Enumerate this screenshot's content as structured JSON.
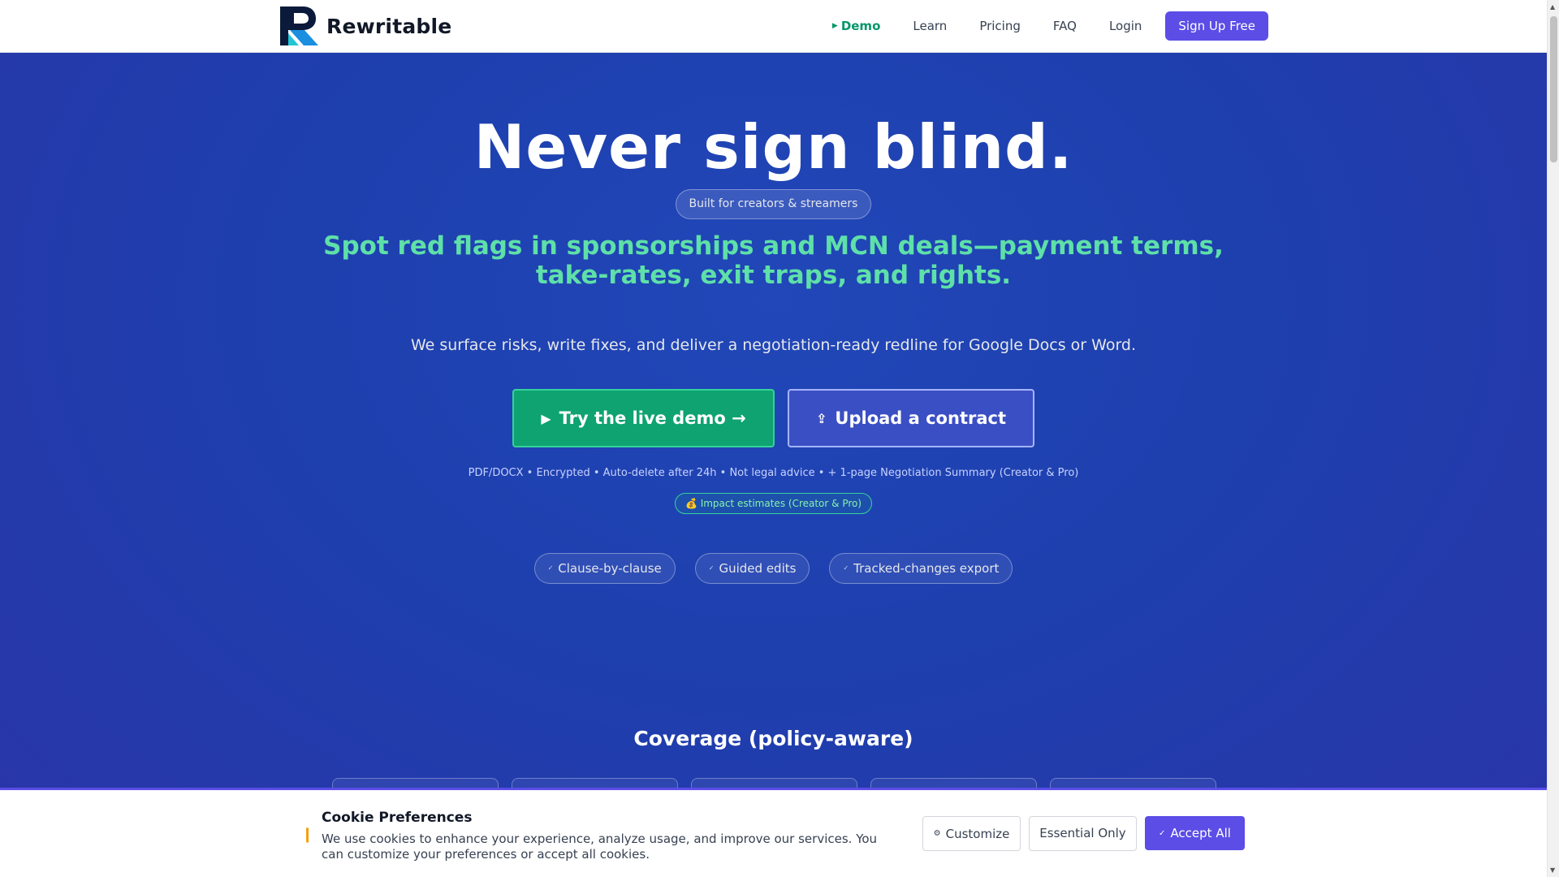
{
  "header": {
    "brand_name": "Rewritable",
    "nav": {
      "demo": "Demo",
      "learn": "Learn",
      "pricing": "Pricing",
      "faq": "FAQ",
      "login": "Login",
      "signup": "Sign Up Free"
    }
  },
  "hero": {
    "title": "Never sign blind.",
    "tag": "Built for creators & streamers",
    "subhead_line1": "Spot red flags in sponsorships and MCN deals—payment terms,",
    "subhead_line2": "take-rates, exit traps, and rights.",
    "lede": "We surface risks, write fixes, and deliver a negotiation-ready redline for Google Docs or Word.",
    "cta_demo": "Try the live demo →",
    "cta_upload": "Upload a contract",
    "fineprint": "PDF/DOCX • Encrypted • Auto-delete after 24h • Not legal advice • + 1-page Negotiation Summary (Creator & Pro)",
    "impact_badge": "💰 Impact estimates (Creator & Pro)",
    "features": [
      "Clause-by-clause",
      "Guided edits",
      "Tracked-changes export"
    ]
  },
  "coverage": {
    "title": "Coverage (policy-aware)"
  },
  "cookie": {
    "title": "Cookie Preferences",
    "text": "We use cookies to enhance your experience, analyze usage, and improve our services. You can customize your preferences or accept all cookies.",
    "customize": "Customize",
    "essential": "Essential Only",
    "accept": "Accept All"
  },
  "colors": {
    "brand_purple": "#5b4de6",
    "accent_green": "#5ee0a8",
    "hero_blue": "#1e3fae"
  },
  "icons": {
    "demo": "play-icon",
    "upload": "upload-icon",
    "feature": "check-icon",
    "cookie": "cookie-icon",
    "customize": "gear-icon",
    "accept": "check-icon"
  }
}
